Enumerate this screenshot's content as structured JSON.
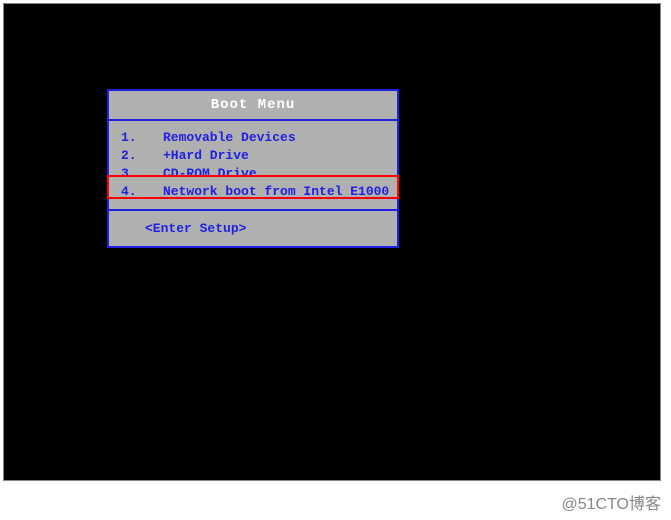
{
  "bootMenu": {
    "title": "Boot Menu",
    "items": [
      {
        "num": "1.",
        "label": "Removable Devices"
      },
      {
        "num": "2.",
        "label": "+Hard Drive"
      },
      {
        "num": "3.",
        "label": "CD-ROM Drive"
      },
      {
        "num": "4.",
        "label": "Network boot from Intel E1000"
      }
    ],
    "footer": "<Enter Setup>"
  },
  "watermark": "@51CTO博客"
}
